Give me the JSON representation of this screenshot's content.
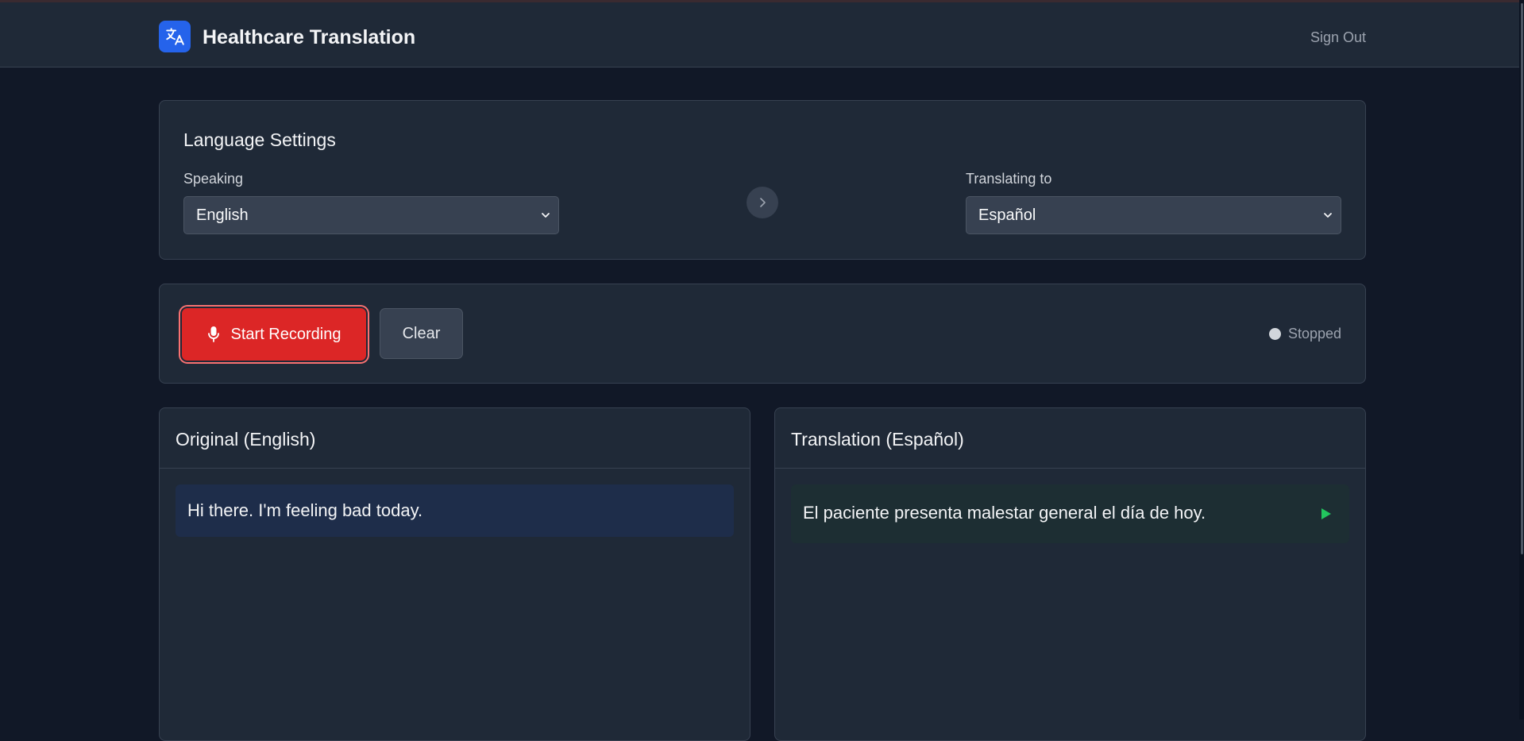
{
  "header": {
    "app_title": "Healthcare Translation",
    "logo_icon": "translate-icon",
    "sign_out_label": "Sign Out"
  },
  "settings": {
    "title": "Language Settings",
    "speaking_label": "Speaking",
    "speaking_value": "English",
    "translating_label": "Translating to",
    "translating_value": "Español",
    "swap_icon": "chevron-right-icon"
  },
  "controls": {
    "record_label": "Start Recording",
    "record_icon": "microphone-icon",
    "clear_label": "Clear",
    "status_text": "Stopped"
  },
  "panels": {
    "original": {
      "title": "Original (English)",
      "message": "Hi there. I'm feeling bad today."
    },
    "translation": {
      "title": "Translation (Español)",
      "message": "El paciente presenta malestar general el día de hoy.",
      "play_icon": "play-icon"
    }
  },
  "colors": {
    "background": "#111827",
    "card": "#1f2937",
    "accent_blue": "#2563eb",
    "record_red": "#dc2626",
    "play_green": "#22c55e"
  }
}
